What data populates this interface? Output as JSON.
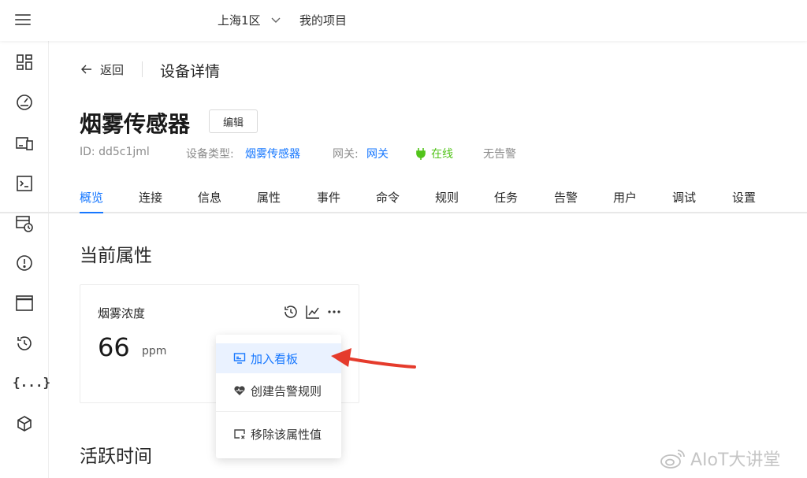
{
  "topbar": {
    "region": "上海1区",
    "project": "我的项目"
  },
  "sidebar": {
    "icons": [
      "dashboard-icon",
      "gauge-icon",
      "devices-icon",
      "terminal-icon",
      "schedule-icon",
      "alert-icon",
      "window-icon",
      "history-icon",
      "braces-icon",
      "package-icon"
    ],
    "braces_label": "{...}"
  },
  "header": {
    "back_label": "返回",
    "page_title": "设备详情"
  },
  "device": {
    "name": "烟雾传感器",
    "edit_label": "编辑",
    "id_label": "ID: dd5c1jml",
    "type_label": "设备类型:",
    "type_value": "烟雾传感器",
    "gateway_label": "网关:",
    "gateway_value": "网关",
    "status": "在线",
    "alarm": "无告警"
  },
  "tabs": [
    "概览",
    "连接",
    "信息",
    "属性",
    "事件",
    "命令",
    "规则",
    "任务",
    "告警",
    "用户",
    "调试",
    "设置"
  ],
  "active_tab": "概览",
  "sections": {
    "current_props": "当前属性",
    "active_time": "活跃时间"
  },
  "property_card": {
    "name": "烟雾浓度",
    "value": "66",
    "unit": "ppm"
  },
  "dropdown": {
    "items": [
      "加入看板",
      "创建告警规则",
      "移除该属性值"
    ]
  },
  "watermark": {
    "text": "AIoT大讲堂"
  },
  "colors": {
    "accent": "#1677ff",
    "online": "#52c41a",
    "arrow": "#e53b2c",
    "hover_bg": "#eaf2ff"
  }
}
